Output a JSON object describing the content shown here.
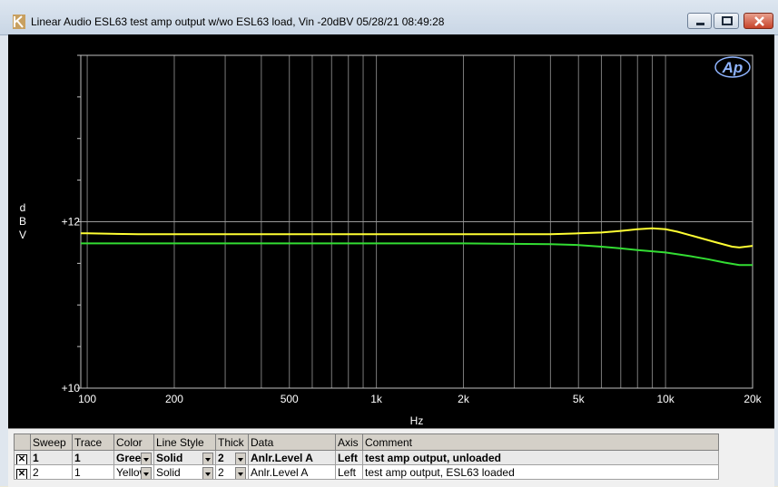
{
  "window": {
    "title": "Linear Audio  ESL63 test amp output w/wo ESL63 load, Vin -20dBV  05/28/21 08:49:28"
  },
  "chart_data": {
    "type": "line",
    "xscale": "log",
    "xlim": [
      95,
      20000
    ],
    "ylim": [
      10,
      14
    ],
    "xlabel": "Hz",
    "ylabel": "dBV",
    "ylabel_letters": [
      "d",
      "B",
      "V"
    ],
    "x_ticks": [
      {
        "value": 100,
        "label": "100"
      },
      {
        "value": 200,
        "label": "200"
      },
      {
        "value": 500,
        "label": "500"
      },
      {
        "value": 1000,
        "label": "1k"
      },
      {
        "value": 2000,
        "label": "2k"
      },
      {
        "value": 5000,
        "label": "5k"
      },
      {
        "value": 10000,
        "label": "10k"
      },
      {
        "value": 20000,
        "label": "20k"
      }
    ],
    "y_ticks": [
      {
        "value": 10,
        "label": "+10"
      },
      {
        "value": 12,
        "label": "+12"
      }
    ],
    "series": [
      {
        "name": "test amp output, unloaded",
        "color": "#ffff33",
        "points": [
          [
            95,
            11.86
          ],
          [
            100,
            11.86
          ],
          [
            150,
            11.85
          ],
          [
            200,
            11.85
          ],
          [
            500,
            11.85
          ],
          [
            1000,
            11.85
          ],
          [
            2000,
            11.85
          ],
          [
            4000,
            11.85
          ],
          [
            5000,
            11.86
          ],
          [
            6000,
            11.87
          ],
          [
            7000,
            11.89
          ],
          [
            8000,
            11.91
          ],
          [
            9000,
            11.92
          ],
          [
            10000,
            11.91
          ],
          [
            11000,
            11.88
          ],
          [
            13000,
            11.81
          ],
          [
            15000,
            11.75
          ],
          [
            17000,
            11.7
          ],
          [
            18000,
            11.69
          ],
          [
            20000,
            11.71
          ]
        ]
      },
      {
        "name": "test amp output, ESL63 loaded",
        "color": "#33dd33",
        "points": [
          [
            95,
            11.74
          ],
          [
            100,
            11.74
          ],
          [
            200,
            11.74
          ],
          [
            500,
            11.74
          ],
          [
            1000,
            11.74
          ],
          [
            2000,
            11.74
          ],
          [
            4000,
            11.73
          ],
          [
            5000,
            11.72
          ],
          [
            6000,
            11.7
          ],
          [
            7000,
            11.68
          ],
          [
            8000,
            11.66
          ],
          [
            10000,
            11.63
          ],
          [
            12000,
            11.59
          ],
          [
            14000,
            11.55
          ],
          [
            16000,
            11.51
          ],
          [
            18000,
            11.48
          ],
          [
            20000,
            11.48
          ]
        ]
      }
    ],
    "grid": true,
    "logo": "Ap"
  },
  "sweep_table": {
    "headers": [
      "Sweep",
      "Trace",
      "Color",
      "Line Style",
      "Thick",
      "Data",
      "Axis",
      "Comment"
    ],
    "rows": [
      {
        "sweep": "1",
        "trace": "1",
        "color": "Green",
        "line_style": "Solid",
        "thick": "2",
        "data": "Anlr.Level A",
        "axis": "Left",
        "comment": "test amp output, unloaded"
      },
      {
        "sweep": "2",
        "trace": "1",
        "color": "Yellow",
        "line_style": "Solid",
        "thick": "2",
        "data": "Anlr.Level A",
        "axis": "Left",
        "comment": "test amp output, ESL63 loaded"
      }
    ]
  }
}
